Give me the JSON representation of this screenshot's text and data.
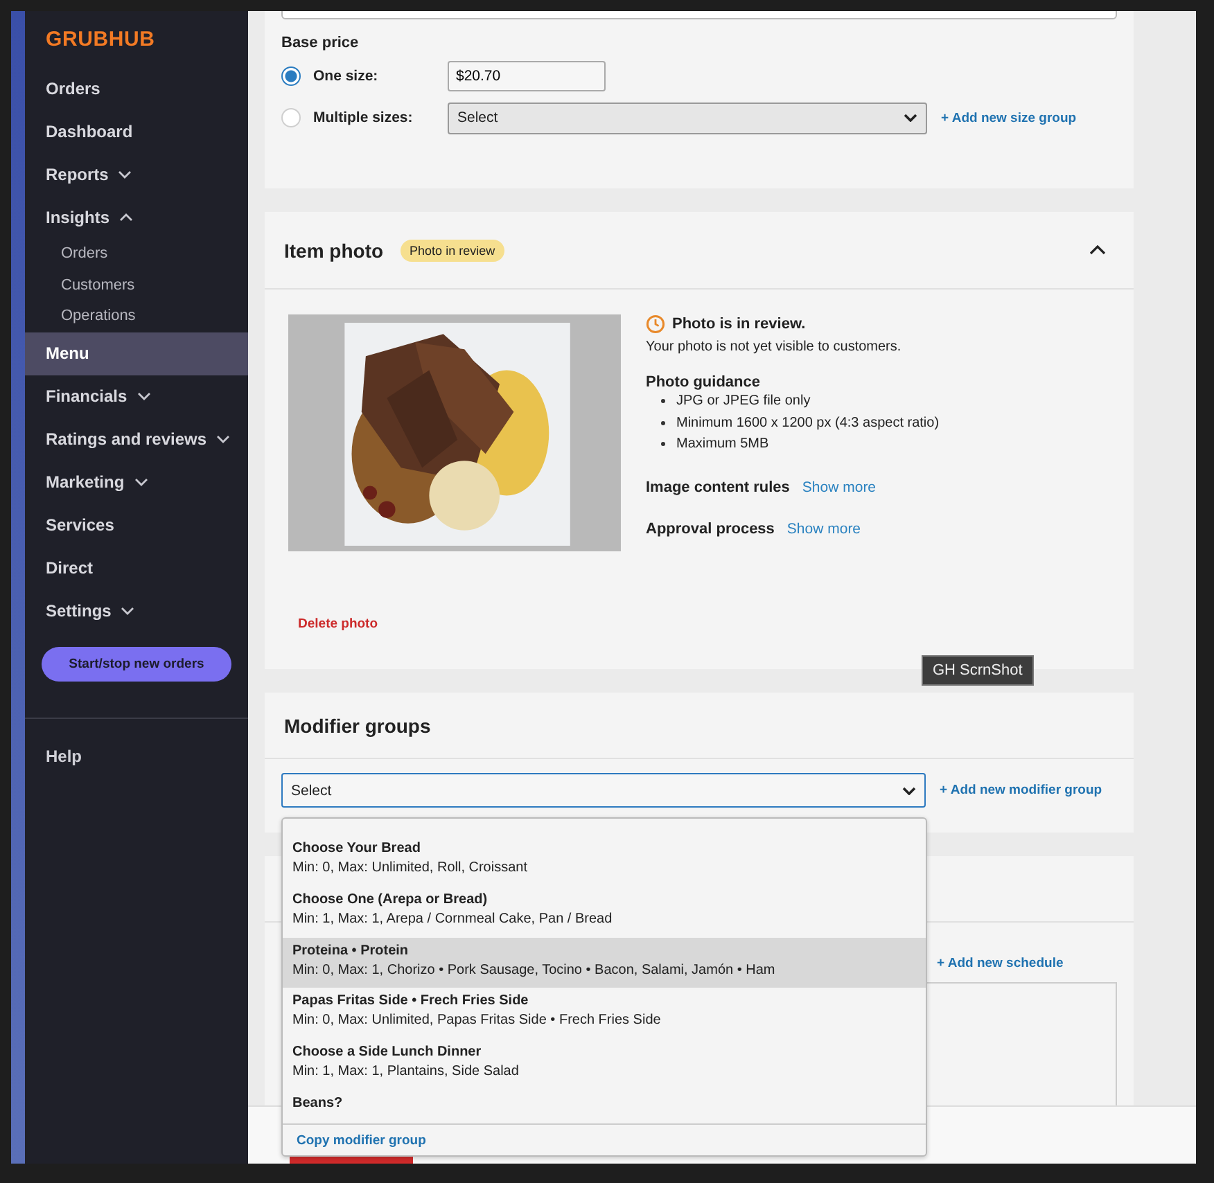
{
  "sidebar": {
    "logo": "GRUBHUB",
    "items": [
      {
        "label": "Orders",
        "selected": false
      },
      {
        "label": "Dashboard",
        "selected": false
      },
      {
        "label": "Reports",
        "selected": false,
        "expanded": false
      },
      {
        "label": "Insights",
        "selected": false,
        "expanded": true,
        "children": [
          {
            "label": "Orders"
          },
          {
            "label": "Customers"
          },
          {
            "label": "Operations"
          }
        ]
      },
      {
        "label": "Menu",
        "selected": true
      },
      {
        "label": "Financials",
        "selected": false,
        "expanded": false
      },
      {
        "label": "Ratings and reviews",
        "selected": false,
        "expanded": false
      },
      {
        "label": "Marketing",
        "selected": false,
        "expanded": false
      },
      {
        "label": "Services",
        "selected": false
      },
      {
        "label": "Direct",
        "selected": false
      },
      {
        "label": "Settings",
        "selected": false,
        "expanded": false
      }
    ],
    "action_button": "Start/stop new orders",
    "footer_items": [
      {
        "label": "Help"
      }
    ]
  },
  "base_price": {
    "title": "Base price",
    "options": [
      {
        "label": "One size:",
        "selected": true,
        "kind": "text",
        "value": "$20.70"
      },
      {
        "label": "Multiple sizes:",
        "selected": false,
        "kind": "select",
        "value": "Select",
        "link": "+ Add new size group"
      }
    ]
  },
  "item_photo": {
    "title": "Item photo",
    "badge": "Photo in review",
    "expanded": true,
    "status_title": "Photo is in review.",
    "status_text": "Your photo is not yet visible to customers.",
    "guidance_title": "Photo guidance",
    "guidance": [
      "JPG or JPEG file only",
      "Minimum 1600 x 1200 px (4:3 aspect ratio)",
      "Maximum 5MB"
    ],
    "rules": [
      {
        "label": "Image content rules",
        "link": "Show more"
      },
      {
        "label": "Approval process",
        "link": "Show more"
      }
    ],
    "delete": "Delete photo"
  },
  "tooltip": "GH ScrnShot",
  "modifier_groups": {
    "title": "Modifier groups",
    "select_value": "Select",
    "link": "+ Add new modifier group",
    "options": [
      {
        "title": "Choose Your Bread",
        "detail": "Min: 0, Max: Unlimited, Roll, Croissant",
        "selected": false
      },
      {
        "title": "Choose One (Arepa or Bread)",
        "detail": "Min: 1, Max: 1, Arepa / Cornmeal Cake, Pan / Bread",
        "selected": false
      },
      {
        "title": "Proteina • Protein",
        "detail": "Min: 0, Max: 1, Chorizo • Pork Sausage, Tocino • Bacon, Salami, Jamón • Ham",
        "selected": true
      },
      {
        "title": "Papas Fritas Side • Frech Fries Side",
        "detail": "Min: 0, Max: Unlimited, Papas Fritas Side • Frech Fries Side",
        "selected": false
      },
      {
        "title": "Choose a Side Lunch Dinner",
        "detail": "Min: 1, Max: 1, Plantains, Side Salad",
        "selected": false
      },
      {
        "title": "Beans?",
        "selected": false
      }
    ],
    "footer_link": "Copy modifier group"
  },
  "schedule": {
    "link": "+ Add new schedule"
  }
}
